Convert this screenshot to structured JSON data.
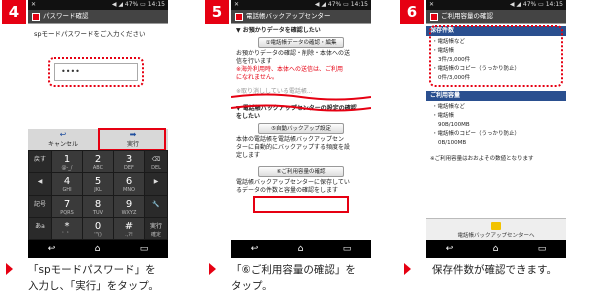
{
  "steps": [
    {
      "number": "4",
      "caption_line1": "「spモードパスワード」を",
      "caption_line2": "入力し、「実行」をタップ。"
    },
    {
      "number": "5",
      "caption_line1": "「⑥ご利用容量の確認」を",
      "caption_line2": "タップ。"
    },
    {
      "number": "6",
      "caption_line1": "保存件数が確認できます。",
      "caption_line2": ""
    }
  ],
  "status_bar": {
    "left": "✕",
    "right": "◀ ◢ 47% ▭ 14:15"
  },
  "screen1": {
    "title": "パスワード確認",
    "prompt": "spモードパスワードをご入力ください",
    "password_value": "••••",
    "cancel_label": "キャンセル",
    "execute_label": "実行",
    "keys": [
      {
        "main": "戻す",
        "sub": ""
      },
      {
        "main": "1",
        "sub": "@-_/"
      },
      {
        "main": "2",
        "sub": "ABC"
      },
      {
        "main": "3",
        "sub": "DEF"
      },
      {
        "main": "⌫",
        "sub": "DEL"
      },
      {
        "main": "◀",
        "sub": ""
      },
      {
        "main": "4",
        "sub": "GHI"
      },
      {
        "main": "5",
        "sub": "JKL"
      },
      {
        "main": "6",
        "sub": "MNO"
      },
      {
        "main": "▶",
        "sub": ""
      },
      {
        "main": "記号",
        "sub": ""
      },
      {
        "main": "7",
        "sub": "PQRS"
      },
      {
        "main": "8",
        "sub": "TUV"
      },
      {
        "main": "9",
        "sub": "WXYZ"
      },
      {
        "main": "🔧",
        "sub": ""
      },
      {
        "main": "あa",
        "sub": ""
      },
      {
        "main": "*",
        "sub": "゛゜"
      },
      {
        "main": "0",
        "sub": "'\"()"
      },
      {
        "main": "#",
        "sub": ".,?!"
      },
      {
        "main": "実行",
        "sub": "確定"
      }
    ]
  },
  "screen2": {
    "title": "電話帳バックアップセンター",
    "section1_heading": "▼ お預かりデータを確認したい",
    "button1": "①電話帳データの確認・編集",
    "text1": "お預かりデータの確認・削除・本体への送",
    "text1b": "信を行います",
    "red_text": "※海外利用時、本体への送信は、ご利用",
    "red_text2": "になれません。",
    "grey_text": "※取り消ししている電話帳...",
    "section2_heading": "▼ 電話帳バックアップセンターの設定の確認",
    "section2_heading2": "をしたい",
    "button2": "⑤自動バックアップ設定",
    "text2": "本体の電話帳を電話帳バックアップセン",
    "text2b": "ターに自動的にバックアップする頻度を設",
    "text2c": "定します",
    "button3": "⑥ご利用容量の確認",
    "text3": "電話帳バックアップセンターに保存してい",
    "text3b": "るデータの件数と容量の確認をします"
  },
  "screen3": {
    "title": "ご利用容量の確認",
    "section1": "保存件数",
    "s1_item1": "・電話帳など",
    "s1_item2": "・電話帳",
    "s1_item2v": "3件/3,000件",
    "s1_item3": "・電話帳のコピー（うっかり防止）",
    "s1_item3v": "0件/3,000件",
    "section2": "ご利用容量",
    "s2_item1": "・電話帳など",
    "s2_item2": "・電話帳",
    "s2_item2v": "90B/100MB",
    "s2_item3": "・電話帳のコピー（うっかり防止）",
    "s2_item3v": "0B/100MB",
    "note": "※ご利用容量はおおよその数値となります",
    "footer": "電話帳バックアップセンターへ"
  },
  "nav": {
    "back": "↩",
    "home": "⌂",
    "recent": "▭"
  },
  "colors": {
    "accent": "#e60012",
    "section": "#2a4f8f"
  }
}
